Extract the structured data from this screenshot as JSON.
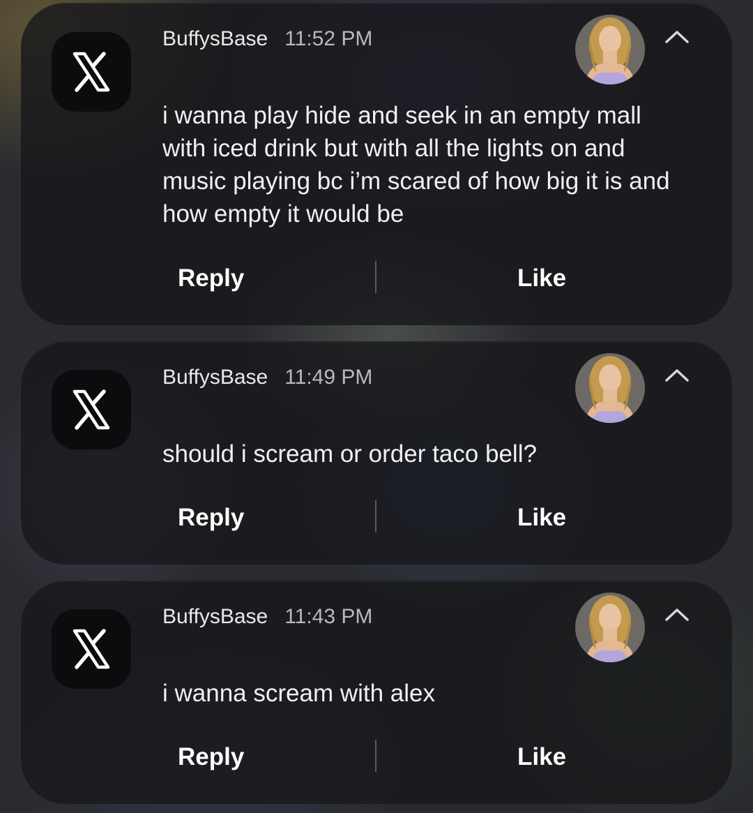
{
  "colors": {
    "card_background": "#18191c",
    "app_icon_background": "#0b0c0e",
    "sender_text": "#e9e9ec",
    "time_text": "#b9bac0",
    "message_text": "#f1f1f3",
    "action_text": "#ffffff"
  },
  "notifications": [
    {
      "app_icon": "x-logo-icon",
      "sender": "BuffysBase",
      "time": "11:52 PM",
      "avatar": "avatar-photo",
      "collapse_icon": "chevron-up-icon",
      "message": "i wanna play hide and seek in an empty mall with iced drink but with all the lights on and music playing bc i’m scared of how big it is and how empty it would be",
      "reply_label": "Reply",
      "like_label": "Like"
    },
    {
      "app_icon": "x-logo-icon",
      "sender": "BuffysBase",
      "time": "11:49 PM",
      "avatar": "avatar-photo",
      "collapse_icon": "chevron-up-icon",
      "message": "should i scream or order taco bell?",
      "reply_label": "Reply",
      "like_label": "Like"
    },
    {
      "app_icon": "x-logo-icon",
      "sender": "BuffysBase",
      "time": "11:43 PM",
      "avatar": "avatar-photo",
      "collapse_icon": "chevron-up-icon",
      "message": "i wanna scream with alex",
      "reply_label": "Reply",
      "like_label": "Like"
    }
  ]
}
